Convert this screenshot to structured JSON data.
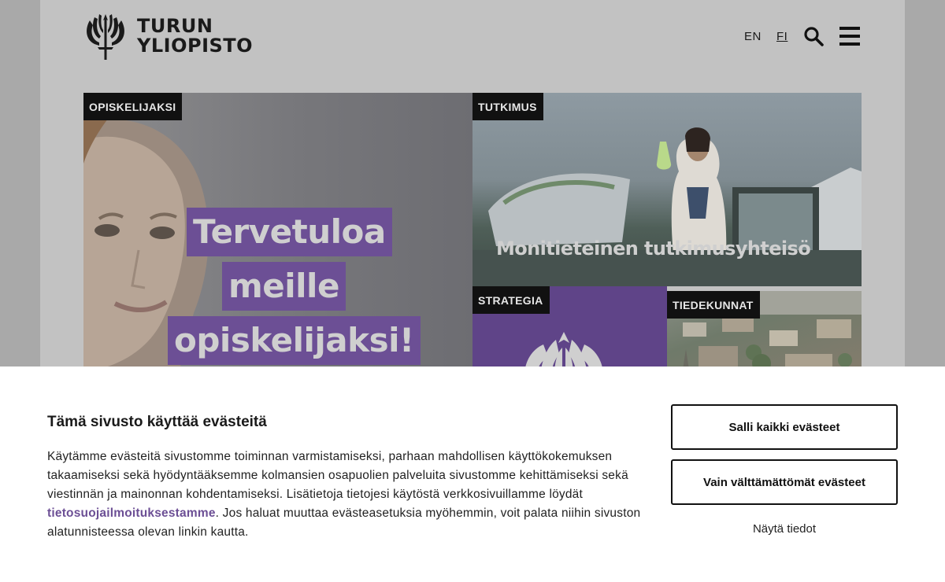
{
  "header": {
    "logo_line1": "TURUN",
    "logo_line2": "YLIOPISTO",
    "lang_en": "EN",
    "lang_fi": "FI",
    "search_icon": "search-icon",
    "menu_icon": "hamburger-menu-icon"
  },
  "tiles": {
    "students": {
      "label": "OPISKELIJAKSI",
      "headline": [
        "Tervetuloa",
        "meille",
        "opiskelijaksi!"
      ]
    },
    "research": {
      "label": "TUTKIMUS",
      "caption": "Monitieteinen tutkimusyhteisö"
    },
    "strategy": {
      "label": "STRATEGIA"
    },
    "faculties": {
      "label": "TIEDEKUNNAT"
    }
  },
  "cookie": {
    "title": "Tämä sivusto käyttää evästeitä",
    "body_before_link": "Käytämme evästeitä sivustomme toiminnan varmistamiseksi, parhaan mahdollisen käyttökokemuksen takaamiseksi sekä hyödyntääksemme kolmansien osapuolien palveluita sivustomme kehittämiseksi sekä viestinnän ja mainonnan kohdentamiseksi. Lisätietoja tietojesi käytöstä verkkosivuillamme löydät ",
    "link_text": "tietosuojailmoituksestamme",
    "body_after_link": ". Jos haluat muuttaa evästeasetuksia myöhemmin, voit palata niihin sivuston alatunnisteessa olevan linkin kautta.",
    "allow_all_button": "Salli kaikki evästeet",
    "necessary_only_button": "Vain välttämättömät evästeet",
    "show_details_link": "Näytä tiedot"
  },
  "colors": {
    "brand_purple": "#6c4f95",
    "overlay_gray": "#c2c2c2",
    "label_black": "#111111"
  }
}
